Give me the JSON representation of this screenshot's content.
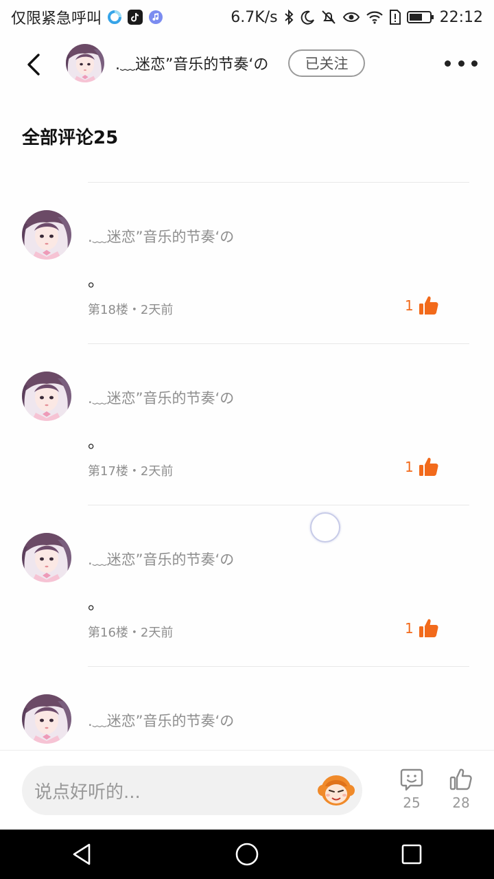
{
  "status_bar": {
    "carrier": "仅限紧急呼叫",
    "net_speed": "6.7K/s",
    "time": "22:12"
  },
  "header": {
    "user_name": ".﹏迷恋”音乐的节奏‘の",
    "follow_label": "已关注"
  },
  "section": {
    "title": "全部评论25"
  },
  "comments": [
    {
      "name": ".﹏迷恋”音乐的节奏‘の",
      "text": "。",
      "meta": "第18楼・2天前",
      "likes": "1"
    },
    {
      "name": ".﹏迷恋”音乐的节奏‘の",
      "text": "。",
      "meta": "第17楼・2天前",
      "likes": "1"
    },
    {
      "name": ".﹏迷恋”音乐的节奏‘の",
      "text": "。",
      "meta": "第16楼・2天前",
      "likes": "1"
    },
    {
      "name": ".﹏迷恋”音乐的节奏‘の"
    }
  ],
  "bottom_bar": {
    "input_placeholder": "说点好听的...",
    "comment_count": "25",
    "like_count": "28"
  },
  "colors": {
    "accent": "#f26a1b",
    "muted_text": "#8e8e8e",
    "background": "#fefefe"
  },
  "icons": {
    "back": "back-arrow-icon",
    "more": "more-dots-icon",
    "like": "thumbs-up-icon",
    "comment": "comment-bubble-icon"
  }
}
